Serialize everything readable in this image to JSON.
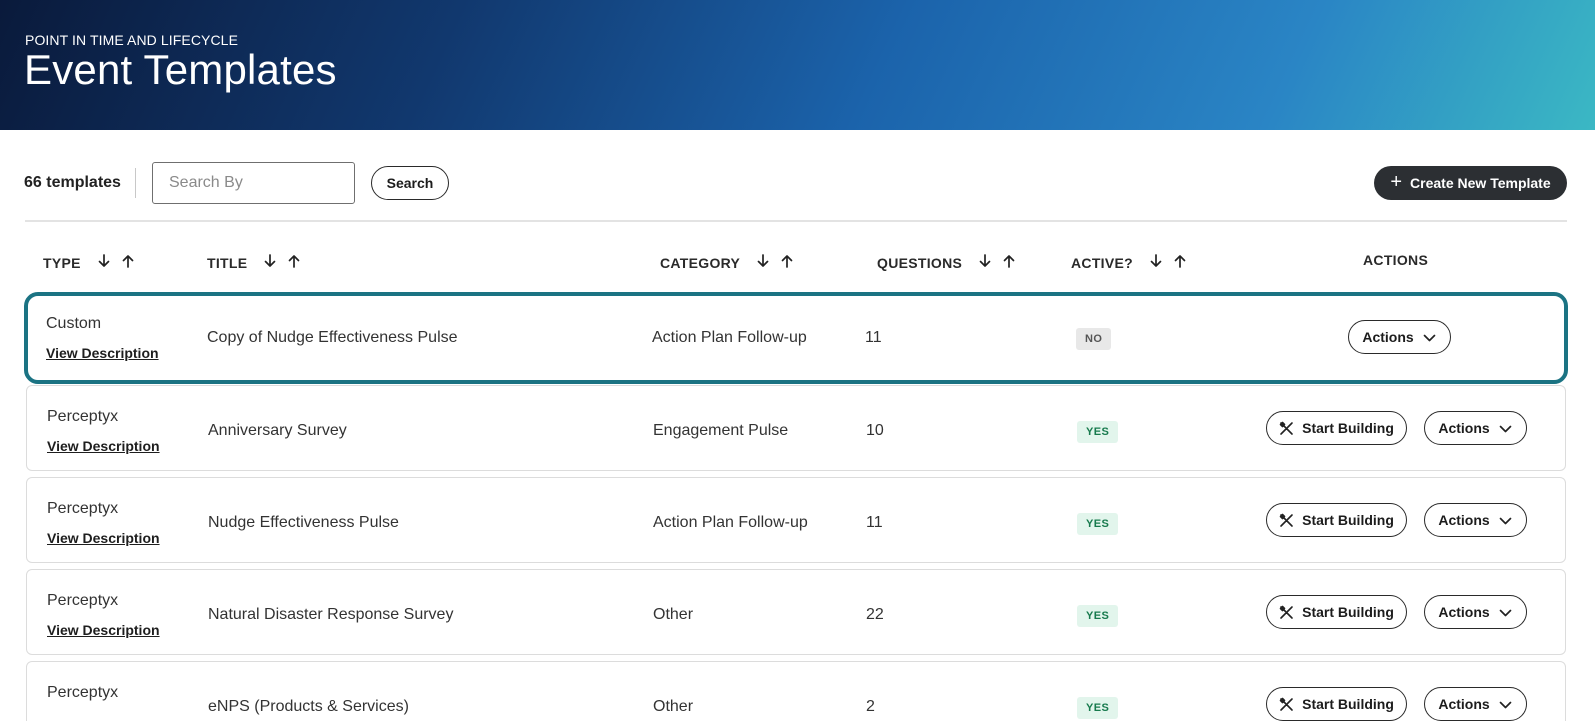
{
  "header": {
    "eyebrow": "POINT IN TIME AND LIFECYCLE",
    "title": "Event Templates"
  },
  "toolbar": {
    "count": "66 templates",
    "search_placeholder": "Search By",
    "search_label": "Search",
    "create_label": "Create New Template"
  },
  "table": {
    "columns": {
      "type": "TYPE",
      "title": "TITLE",
      "category": "CATEGORY",
      "questions": "QUESTIONS",
      "active": "ACTIVE?",
      "actions": "ACTIONS"
    },
    "view_description_label": "View Description",
    "start_building_label": "Start Building",
    "actions_label": "Actions",
    "rows": [
      {
        "type": "Custom",
        "title": "Copy of Nudge Effectiveness Pulse",
        "category": "Action Plan Follow-up",
        "questions": "11",
        "active": "NO",
        "selected": true
      },
      {
        "type": "Perceptyx",
        "title": "Anniversary Survey",
        "category": "Engagement Pulse",
        "questions": "10",
        "active": "YES"
      },
      {
        "type": "Perceptyx",
        "title": "Nudge Effectiveness Pulse",
        "category": "Action Plan Follow-up",
        "questions": "11",
        "active": "YES"
      },
      {
        "type": "Perceptyx",
        "title": "Natural Disaster Response Survey",
        "category": "Other",
        "questions": "22",
        "active": "YES"
      },
      {
        "type": "Perceptyx",
        "title": "eNPS (Products & Services)",
        "category": "Other",
        "questions": "2",
        "active": "YES"
      }
    ]
  },
  "colors": {
    "accent_selected": "#1b7383",
    "primary_button": "#2c2f33",
    "badge_yes_bg": "#e2f5ec",
    "badge_yes_fg": "#177a4d",
    "badge_no_bg": "#e8e8e8"
  },
  "icons": {
    "sort_down": "arrow-down-icon",
    "sort_up": "arrow-up-icon",
    "plus": "plus-icon",
    "build": "tools-icon",
    "dropdown": "chevron-down-icon"
  }
}
